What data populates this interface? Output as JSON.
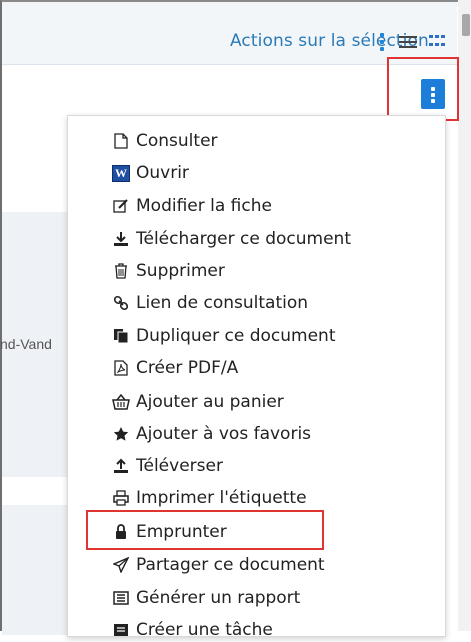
{
  "toolbar": {
    "actions_label": "Actions sur la sélection",
    "icons": [
      "vertical-dots-icon",
      "list-view-icon",
      "grid-view-icon"
    ]
  },
  "kebab_menu_button": {
    "icon": "vertical-dots-icon"
  },
  "background": {
    "partial_text": "nd-Vand"
  },
  "menu": {
    "items": [
      {
        "label": "Consulter",
        "icon": "document-icon"
      },
      {
        "label": "Ouvrir",
        "icon": "word-icon"
      },
      {
        "label": "Modifier la fiche",
        "icon": "edit-icon"
      },
      {
        "label": "Télécharger ce document",
        "icon": "download-icon"
      },
      {
        "label": "Supprimer",
        "icon": "trash-icon"
      },
      {
        "label": "Lien de consultation",
        "icon": "link-icon"
      },
      {
        "label": "Dupliquer ce document",
        "icon": "duplicate-icon"
      },
      {
        "label": "Créer PDF/A",
        "icon": "pdf-icon"
      },
      {
        "label": "Ajouter au panier",
        "icon": "basket-icon"
      },
      {
        "label": "Ajouter à vos favoris",
        "icon": "star-icon"
      },
      {
        "label": "Téléverser",
        "icon": "upload-icon"
      },
      {
        "label": "Imprimer l'étiquette",
        "icon": "print-icon"
      },
      {
        "label": "Emprunter",
        "icon": "lock-icon"
      },
      {
        "label": "Partager ce document",
        "icon": "send-icon"
      },
      {
        "label": "Générer un rapport",
        "icon": "report-icon"
      },
      {
        "label": "Créer une tâche",
        "icon": "task-icon"
      }
    ]
  },
  "colors": {
    "accent": "#1d7ed9",
    "link": "#2a7ab8",
    "highlight_box": "#e23333"
  }
}
